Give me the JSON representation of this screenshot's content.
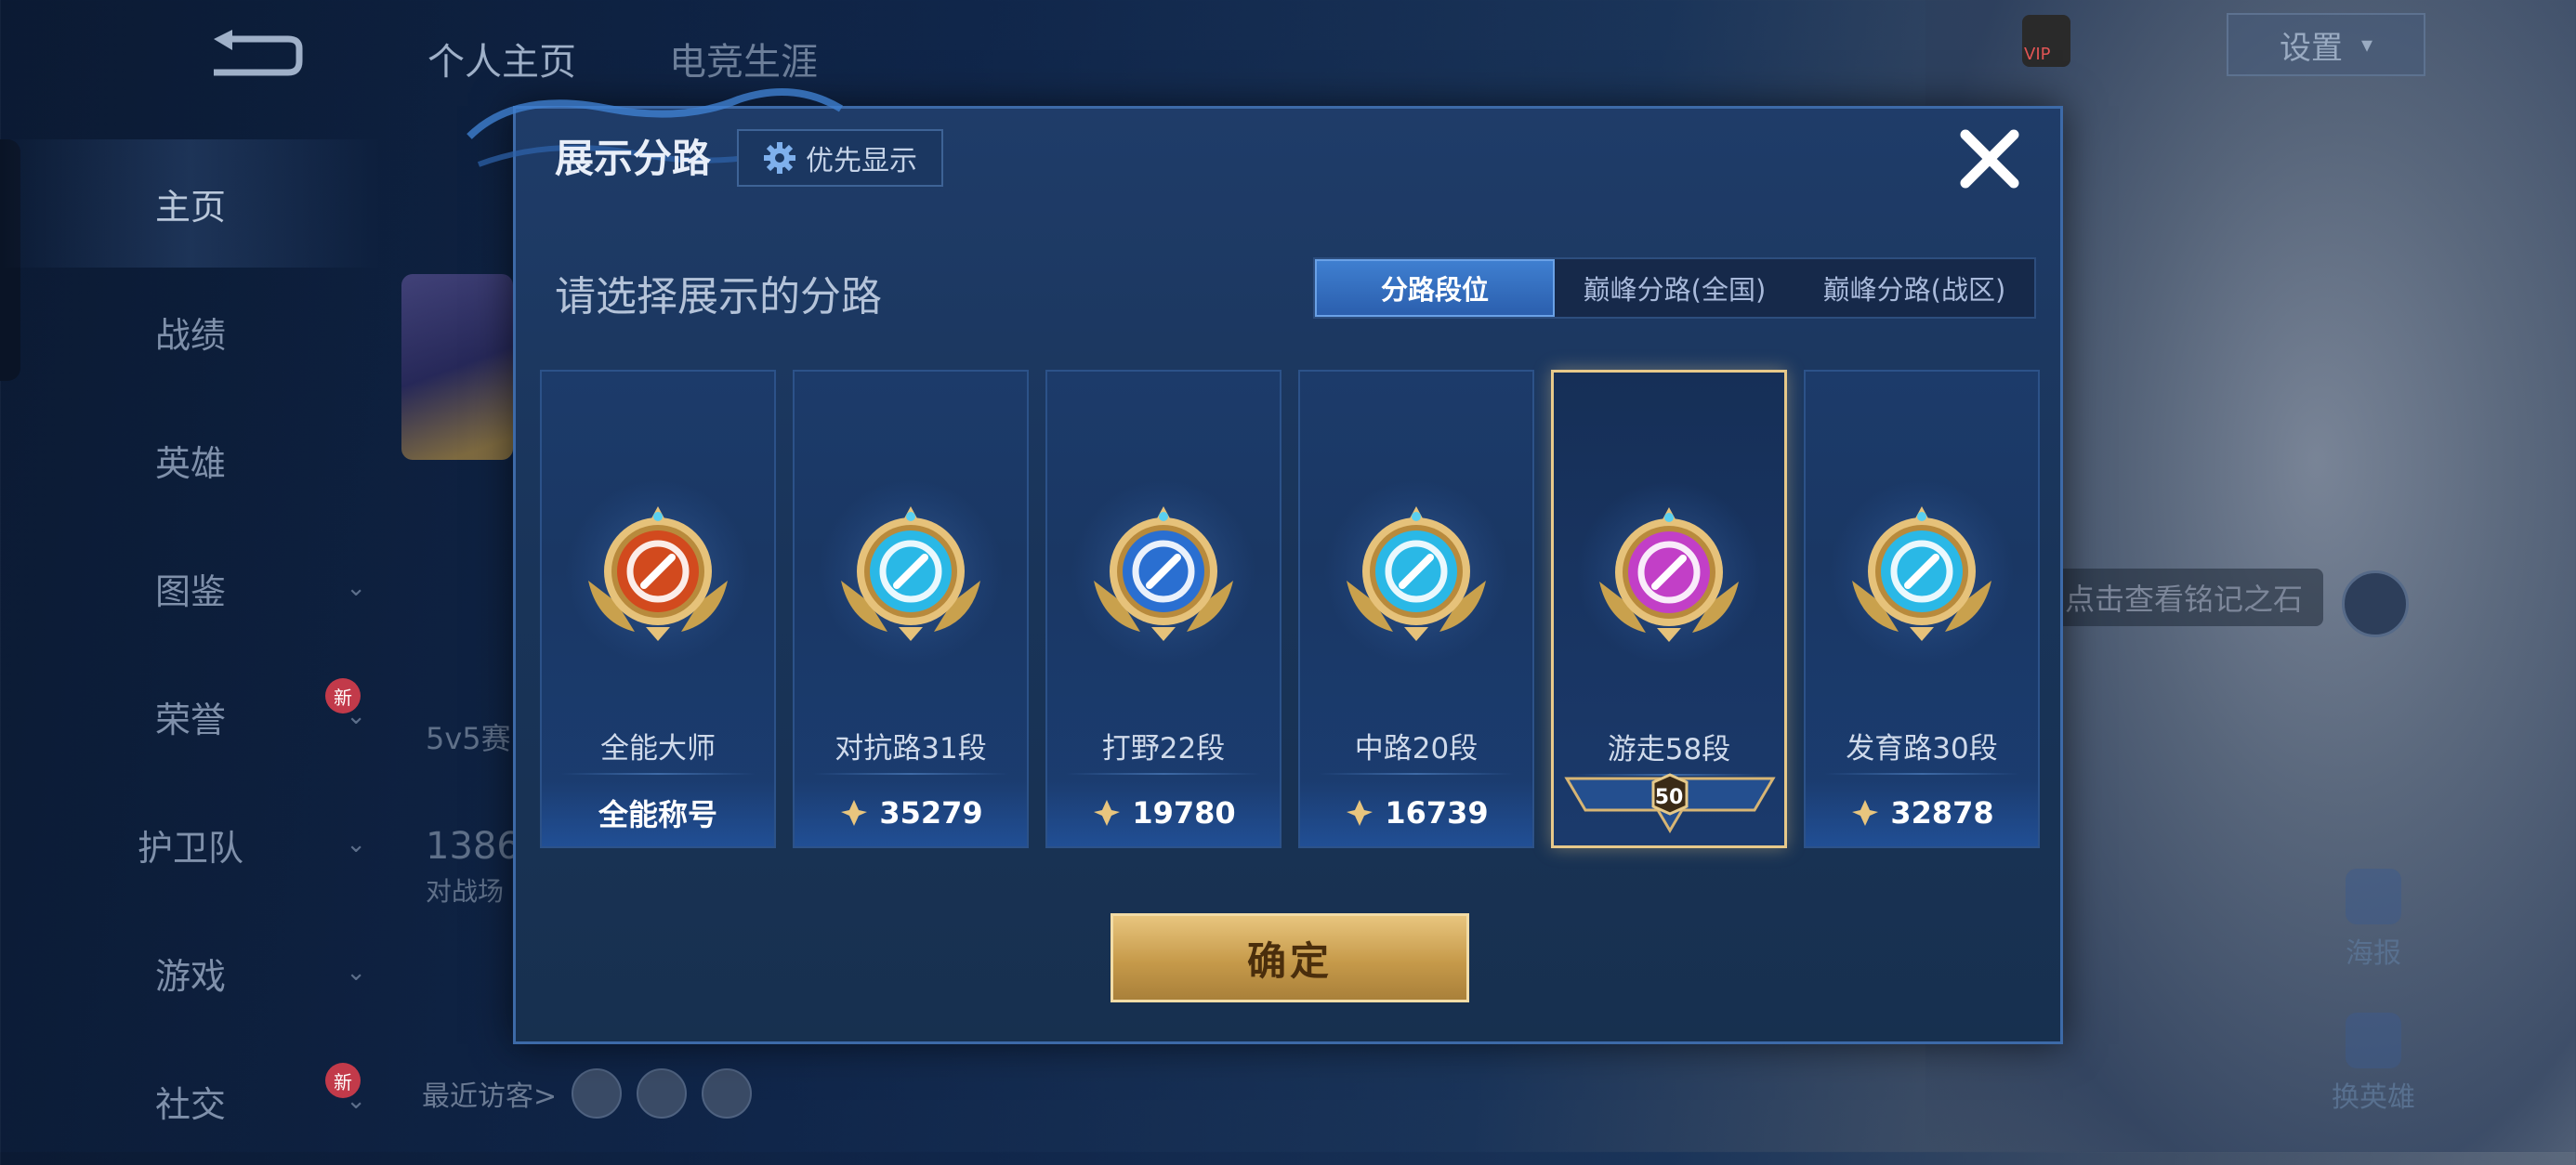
{
  "background": {
    "top_tabs": [
      "个人主页",
      "电竞生涯"
    ],
    "left_nav": [
      {
        "label": "主页",
        "active": true,
        "chevron": false,
        "new": false
      },
      {
        "label": "战绩",
        "active": false,
        "chevron": false,
        "new": false
      },
      {
        "label": "英雄",
        "active": false,
        "chevron": false,
        "new": false
      },
      {
        "label": "图鉴",
        "active": false,
        "chevron": true,
        "new": false
      },
      {
        "label": "荣誉",
        "active": false,
        "chevron": true,
        "new": true
      },
      {
        "label": "护卫队",
        "active": false,
        "chevron": true,
        "new": false
      },
      {
        "label": "游戏",
        "active": false,
        "chevron": true,
        "new": false
      },
      {
        "label": "社交",
        "active": false,
        "chevron": true,
        "new": true
      }
    ],
    "new_badge": "新",
    "mode_text": "5v5赛",
    "count_text": "1386",
    "count_sub": "对战场",
    "recent_visitors": "最近访客>",
    "settings_label": "设置",
    "vip_label": "VIP",
    "stone_tip": "点击查看铭记之石",
    "poster_label": "海报",
    "change_hero_label": "换英雄"
  },
  "modal": {
    "title": "展示分路",
    "priority_label": "优先显示",
    "subtitle": "请选择展示的分路",
    "tabs": [
      "分路段位",
      "巅峰分路(全国)",
      "巅峰分路(战区)"
    ],
    "active_tab": 0,
    "cards": [
      {
        "name": "全能大师",
        "value": "全能称号",
        "badge": "all-round-badge",
        "color": "#d24a1e",
        "has_points": false,
        "selected": false
      },
      {
        "name": "对抗路31段",
        "value": "35279",
        "badge": "clash-lane-badge",
        "color": "#2ab8e6",
        "has_points": true,
        "selected": false
      },
      {
        "name": "打野22段",
        "value": "19780",
        "badge": "jungle-badge",
        "color": "#2a6fd1",
        "has_points": true,
        "selected": false
      },
      {
        "name": "中路20段",
        "value": "16739",
        "badge": "mid-lane-badge",
        "color": "#2ab8e6",
        "has_points": true,
        "selected": false
      },
      {
        "name": "游走58段",
        "value": "50",
        "badge": "roam-badge",
        "color": "#c23fc7",
        "has_points": false,
        "selected": true
      },
      {
        "name": "发育路30段",
        "value": "32878",
        "badge": "farm-lane-badge",
        "color": "#2ab8e6",
        "has_points": true,
        "selected": false
      }
    ],
    "confirm_label": "确定"
  }
}
